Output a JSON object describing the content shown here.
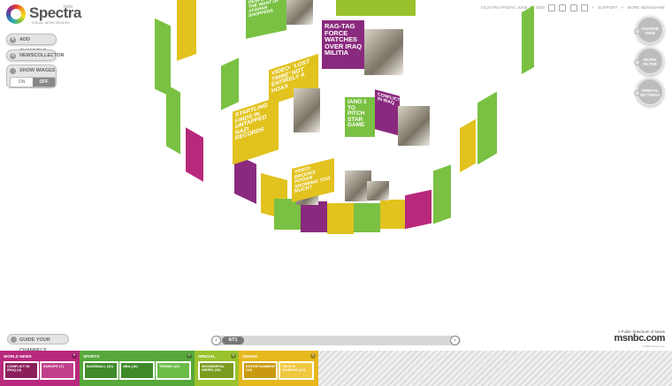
{
  "app": {
    "logo": "Spectra",
    "logo_beta": "beta",
    "logo_tagline": "VISUAL NEWS READER"
  },
  "left_panel": {
    "add_channels": "ADD CHANNELS",
    "news_collector": "NEWSCOLLECTOR",
    "show_images": "SHOW IMAGES",
    "toggle_on": "ON",
    "toggle_off": "OFF"
  },
  "topbar": {
    "datetime": "03:20 PM, FRIDAY, JUNE 27, 2008",
    "support": "SUPPORT",
    "more_newsware": "MORE NEWSWARE"
  },
  "right_controls": [
    {
      "label": "CHANGE VIEW"
    },
    {
      "label": "WORD FILTER"
    },
    {
      "label": "ORBITAL SETTINGS"
    }
  ],
  "cards": [
    {
      "text": "RESPONSE FOR THE WANT OF AFGHAN SHOPPERS",
      "color": "#7ac143"
    },
    {
      "text": "RAG-TAG FORCE WATCHES OVER IRAQ MILITIA",
      "color": "#8a2a7e"
    },
    {
      "text": "VIDEO: 'LOST TRIBE' NOT ENTIRELY A HOAX",
      "color": "#e2c21e"
    },
    {
      "text": "STARTLING FINDS IN UNTAPPED NAZI RECORDS",
      "color": "#e2c21e"
    },
    {
      "text": "IANO 2 TO PITCH STAR GAME",
      "color": "#7ac143"
    },
    {
      "text": "CONFLICT IN IRAQ",
      "color": "#8a2a7e"
    },
    {
      "text": "VIDEO: BROOKE HOGAN SHOWING TOO MUCH?",
      "color": "#e2c21e"
    }
  ],
  "guide_button": "GUIDE YOUR CHANNELS",
  "pager": {
    "count": "6/71"
  },
  "branding": {
    "tagline": "A Fuller Spectrum of News",
    "name": "msnbc.com",
    "fine_print": "© 2008 msnbc.com"
  },
  "trays": [
    {
      "name": "WORLD NEWS",
      "color": "#b8287c",
      "channels": [
        {
          "label": "CONFLICT IN IRAQ (4)"
        },
        {
          "label": "EUROPE (7)"
        }
      ]
    },
    {
      "name": "SPORTS",
      "color": "#56a83a",
      "channels": [
        {
          "label": "BASEBALL (10)"
        },
        {
          "label": "NBA (10)"
        },
        {
          "label": "TENNIS (10)"
        }
      ]
    },
    {
      "name": "SPECIAL",
      "color": "#9ac22c",
      "channels": [
        {
          "label": "WONDERFUL WEIRD (10)"
        }
      ]
    },
    {
      "name": "VIDEOS",
      "color": "#e6b81e",
      "channels": [
        {
          "label": "ENTERTAINMENT (10)"
        },
        {
          "label": "TECH & SCIENCE (10)"
        }
      ]
    }
  ]
}
